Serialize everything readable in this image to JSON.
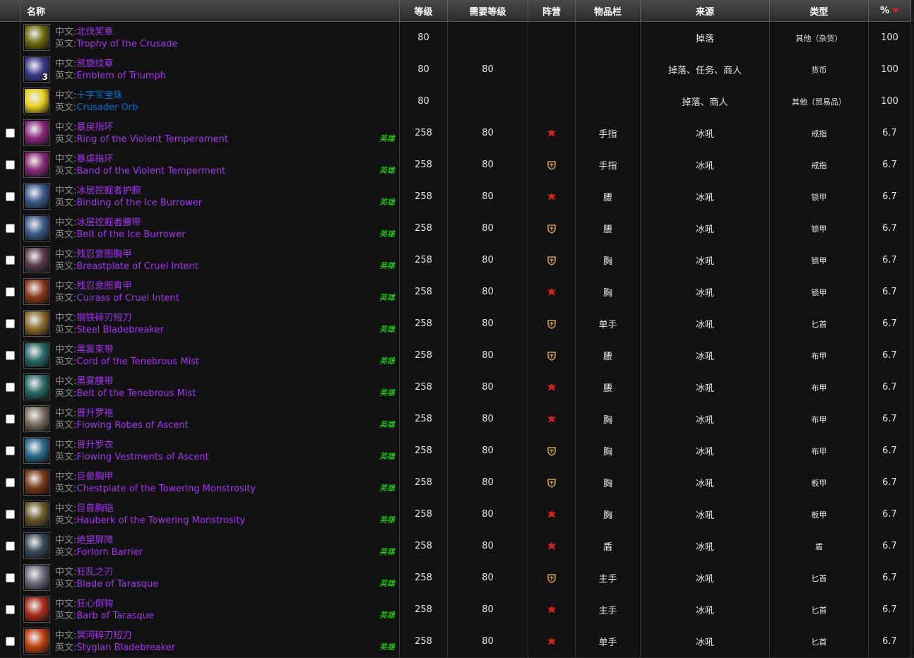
{
  "headers": {
    "name": "名称",
    "level": "等级",
    "req_level": "需要等级",
    "faction": "阵营",
    "slot": "物品栏",
    "source": "来源",
    "type": "类型",
    "percent": "%"
  },
  "labels": {
    "cn": "中文:",
    "en": "英文:"
  },
  "colors": {
    "epic": "#a335ee",
    "rare": "#0070dd",
    "heroic": "#1eff00",
    "horde": "#d32020",
    "alliance": "#c8a040"
  },
  "rows": [
    {
      "cn": "北伐奖章",
      "en": "Trophy of the Crusade",
      "quality": "epic",
      "icon": "trophy-icon",
      "icon_color": "#6f6a10",
      "stack": "",
      "checkbox": false,
      "heroic": "",
      "level": "80",
      "req": "",
      "faction": "none",
      "slot": "",
      "source": "掉落",
      "type": "其他（杂货）",
      "pct": "100"
    },
    {
      "cn": "凯旋纹章",
      "en": "Emblem of Triumph",
      "quality": "epic",
      "icon": "emblem-icon",
      "icon_color": "#3a3a8a",
      "stack": "3",
      "checkbox": false,
      "heroic": "",
      "level": "80",
      "req": "80",
      "faction": "none",
      "slot": "",
      "source": "掉落、任务、商人",
      "type": "货币",
      "pct": "100"
    },
    {
      "cn": "十字军宝珠",
      "en": "Crusader Orb",
      "quality": "rare",
      "icon": "orb-icon",
      "icon_color": "#e8d020",
      "stack": "",
      "checkbox": false,
      "heroic": "",
      "level": "80",
      "req": "",
      "faction": "none",
      "slot": "",
      "source": "掉落、商人",
      "type": "其他（贸易品）",
      "pct": "100"
    },
    {
      "cn": "暴戾指环",
      "en": "Ring of the Violent Temperament",
      "quality": "epic",
      "icon": "ring-icon",
      "icon_color": "#8a2a7a",
      "stack": "",
      "checkbox": true,
      "heroic": "英雄",
      "level": "258",
      "req": "80",
      "faction": "horde",
      "slot": "手指",
      "source": "冰吼",
      "type": "戒指",
      "pct": "6.7"
    },
    {
      "cn": "暴虐指环",
      "en": "Band of the Violent Temperment",
      "quality": "epic",
      "icon": "ring-icon",
      "icon_color": "#8a2a7a",
      "stack": "",
      "checkbox": true,
      "heroic": "英雄",
      "level": "258",
      "req": "80",
      "faction": "alliance",
      "slot": "手指",
      "source": "冰吼",
      "type": "戒指",
      "pct": "6.7"
    },
    {
      "cn": "冰层挖掘者护腕",
      "en": "Binding of the Ice Burrower",
      "quality": "epic",
      "icon": "bracer-icon",
      "icon_color": "#3a5a8a",
      "stack": "",
      "checkbox": true,
      "heroic": "英雄",
      "level": "258",
      "req": "80",
      "faction": "horde",
      "slot": "腰",
      "source": "冰吼",
      "type": "锁甲",
      "pct": "6.7"
    },
    {
      "cn": "冰层挖掘者腰带",
      "en": "Belt of the Ice Burrower",
      "quality": "epic",
      "icon": "belt-icon",
      "icon_color": "#3a5a8a",
      "stack": "",
      "checkbox": true,
      "heroic": "英雄",
      "level": "258",
      "req": "80",
      "faction": "alliance",
      "slot": "腰",
      "source": "冰吼",
      "type": "锁甲",
      "pct": "6.7"
    },
    {
      "cn": "残忍意图胸甲",
      "en": "Breastplate of Cruel Intent",
      "quality": "epic",
      "icon": "chest-icon",
      "icon_color": "#5a3a4a",
      "stack": "",
      "checkbox": true,
      "heroic": "英雄",
      "level": "258",
      "req": "80",
      "faction": "alliance",
      "slot": "胸",
      "source": "冰吼",
      "type": "锁甲",
      "pct": "6.7"
    },
    {
      "cn": "残忍意图胄甲",
      "en": "Cuirass of Cruel Intent",
      "quality": "epic",
      "icon": "chest-icon",
      "icon_color": "#8a3a1a",
      "stack": "",
      "checkbox": true,
      "heroic": "英雄",
      "level": "258",
      "req": "80",
      "faction": "horde",
      "slot": "胸",
      "source": "冰吼",
      "type": "锁甲",
      "pct": "6.7"
    },
    {
      "cn": "钢铁碎刃短刀",
      "en": "Steel Bladebreaker",
      "quality": "epic",
      "icon": "dagger-icon",
      "icon_color": "#8a6a2a",
      "stack": "",
      "checkbox": true,
      "heroic": "英雄",
      "level": "258",
      "req": "80",
      "faction": "alliance",
      "slot": "单手",
      "source": "冰吼",
      "type": "匕首",
      "pct": "6.7"
    },
    {
      "cn": "黑雾束带",
      "en": "Cord of the Tenebrous Mist",
      "quality": "epic",
      "icon": "belt-icon",
      "icon_color": "#2a6a6a",
      "stack": "",
      "checkbox": true,
      "heroic": "英雄",
      "level": "258",
      "req": "80",
      "faction": "alliance",
      "slot": "腰",
      "source": "冰吼",
      "type": "布甲",
      "pct": "6.7"
    },
    {
      "cn": "黑雾腰带",
      "en": "Belt of the Tenebrous Mist",
      "quality": "epic",
      "icon": "belt-icon",
      "icon_color": "#2a6a6a",
      "stack": "",
      "checkbox": true,
      "heroic": "英雄",
      "level": "258",
      "req": "80",
      "faction": "horde",
      "slot": "腰",
      "source": "冰吼",
      "type": "布甲",
      "pct": "6.7"
    },
    {
      "cn": "晋升罗袍",
      "en": "Flowing Robes of Ascent",
      "quality": "epic",
      "icon": "robe-icon",
      "icon_color": "#7a7060",
      "stack": "",
      "checkbox": true,
      "heroic": "英雄",
      "level": "258",
      "req": "80",
      "faction": "horde",
      "slot": "胸",
      "source": "冰吼",
      "type": "布甲",
      "pct": "6.7"
    },
    {
      "cn": "晋升罗衣",
      "en": "Flowing Vestments of Ascent",
      "quality": "epic",
      "icon": "robe-icon",
      "icon_color": "#2a6a8a",
      "stack": "",
      "checkbox": true,
      "heroic": "英雄",
      "level": "258",
      "req": "80",
      "faction": "alliance",
      "slot": "胸",
      "source": "冰吼",
      "type": "布甲",
      "pct": "6.7"
    },
    {
      "cn": "巨兽胸甲",
      "en": "Chestplate of the Towering Monstrosity",
      "quality": "epic",
      "icon": "chest-icon",
      "icon_color": "#7a3a1a",
      "stack": "",
      "checkbox": true,
      "heroic": "英雄",
      "level": "258",
      "req": "80",
      "faction": "alliance",
      "slot": "胸",
      "source": "冰吼",
      "type": "板甲",
      "pct": "6.7"
    },
    {
      "cn": "巨兽胸铠",
      "en": "Hauberk of the Towering Monstrosity",
      "quality": "epic",
      "icon": "chest-icon",
      "icon_color": "#6a5a2a",
      "stack": "",
      "checkbox": true,
      "heroic": "英雄",
      "level": "258",
      "req": "80",
      "faction": "horde",
      "slot": "胸",
      "source": "冰吼",
      "type": "板甲",
      "pct": "6.7"
    },
    {
      "cn": "绝望屏障",
      "en": "Forlorn Barrier",
      "quality": "epic",
      "icon": "shield-icon",
      "icon_color": "#3a4a5a",
      "stack": "",
      "checkbox": true,
      "heroic": "英雄",
      "level": "258",
      "req": "80",
      "faction": "horde",
      "slot": "盾",
      "source": "冰吼",
      "type": "盾",
      "pct": "6.7"
    },
    {
      "cn": "狂乱之刃",
      "en": "Blade of Tarasque",
      "quality": "epic",
      "icon": "dagger-icon",
      "icon_color": "#6a6a7a",
      "stack": "",
      "checkbox": true,
      "heroic": "英雄",
      "level": "258",
      "req": "80",
      "faction": "alliance",
      "slot": "主手",
      "source": "冰吼",
      "type": "匕首",
      "pct": "6.7"
    },
    {
      "cn": "狂心倒钩",
      "en": "Barb of Tarasque",
      "quality": "epic",
      "icon": "dagger-icon",
      "icon_color": "#aa2a1a",
      "stack": "",
      "checkbox": true,
      "heroic": "英雄",
      "level": "258",
      "req": "80",
      "faction": "horde",
      "slot": "主手",
      "source": "冰吼",
      "type": "匕首",
      "pct": "6.7"
    },
    {
      "cn": "冥河碎刃短刀",
      "en": "Stygian Bladebreaker",
      "quality": "epic",
      "icon": "dagger-icon",
      "icon_color": "#c04010",
      "stack": "",
      "checkbox": true,
      "heroic": "英雄",
      "level": "258",
      "req": "80",
      "faction": "horde",
      "slot": "单手",
      "source": "冰吼",
      "type": "匕首",
      "pct": "6.7"
    }
  ]
}
